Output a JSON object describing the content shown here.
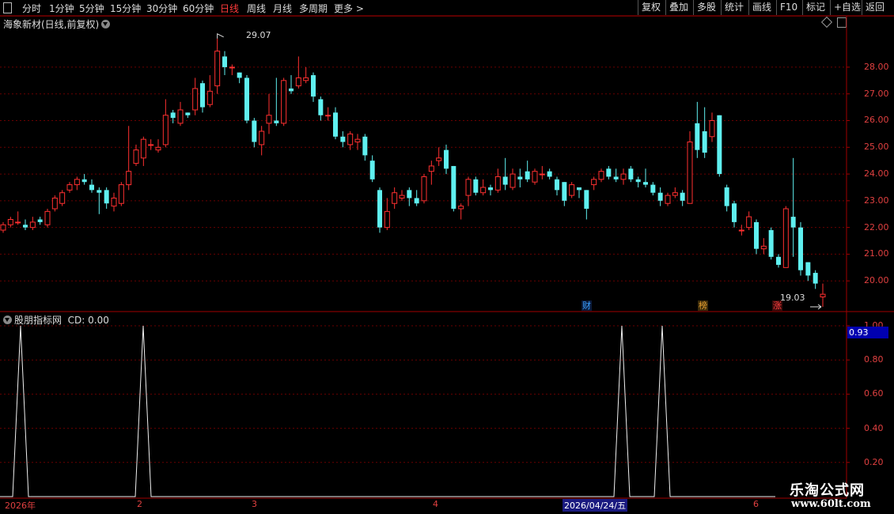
{
  "toolbar": {
    "periods": [
      "分时",
      "1分钟",
      "5分钟",
      "15分钟",
      "30分钟",
      "60分钟",
      "日线",
      "周线",
      "月线",
      "多周期",
      "更多"
    ],
    "active_period": "日线",
    "right_buttons": [
      "复权",
      "叠加",
      "多股",
      "统计",
      "画线",
      "F10",
      "标记",
      "+自选",
      "返回"
    ]
  },
  "main_chart": {
    "title": "海象新材(日线,前复权)",
    "price_labels": [
      "28.00",
      "27.00",
      "26.00",
      "25.00",
      "24.00",
      "23.00",
      "22.00",
      "21.00",
      "20.00"
    ],
    "high_label": "29.07",
    "low_label": "19.03",
    "markers": [
      {
        "text": "财",
        "color": "#3aa0ff"
      },
      {
        "text": "榜",
        "color": "#e8a030"
      },
      {
        "text": "涨",
        "color": "#ff4040"
      }
    ],
    "colors": {
      "up": "#ff3030",
      "down": "#5ff0f0",
      "grid": "#6a0000",
      "axis": "#a00000"
    }
  },
  "indicator": {
    "title": "股朋指标网",
    "cd_label": "CD: 0.00",
    "value_badge": "0.93",
    "axis_labels": [
      "1.00",
      "0.80",
      "0.60",
      "0.40",
      "0.20"
    ]
  },
  "x_axis": {
    "labels": [
      "2026年",
      "2",
      "3",
      "4",
      "2026/04/24/五",
      "6"
    ]
  },
  "watermark": {
    "line1": "乐淘公式网",
    "line2": "www.60lt.com"
  },
  "chart_data": {
    "type": "candlestick",
    "ylim": [
      19.0,
      29.3
    ],
    "candles": [
      [
        21.9,
        22.1,
        21.8,
        22.2
      ],
      [
        22.1,
        22.3,
        22.0,
        22.4
      ],
      [
        22.2,
        22.2,
        22.1,
        22.6
      ],
      [
        22.1,
        22.0,
        21.9,
        22.3
      ],
      [
        22.0,
        22.2,
        21.9,
        22.4
      ],
      [
        22.3,
        22.2,
        22.1,
        22.4
      ],
      [
        22.1,
        22.6,
        22.0,
        22.7
      ],
      [
        22.7,
        23.1,
        22.6,
        23.2
      ],
      [
        22.9,
        23.3,
        22.8,
        23.4
      ],
      [
        23.4,
        23.6,
        23.3,
        23.7
      ],
      [
        23.6,
        23.8,
        23.4,
        23.9
      ],
      [
        23.8,
        23.7,
        23.6,
        24.0
      ],
      [
        23.6,
        23.4,
        23.3,
        23.8
      ],
      [
        23.4,
        23.3,
        22.5,
        23.5
      ],
      [
        23.4,
        22.9,
        22.7,
        23.5
      ],
      [
        22.8,
        23.1,
        22.6,
        23.3
      ],
      [
        22.9,
        23.6,
        22.8,
        23.7
      ],
      [
        23.6,
        24.1,
        23.4,
        25.8
      ],
      [
        24.4,
        24.9,
        24.3,
        25.1
      ],
      [
        24.6,
        25.3,
        24.3,
        25.4
      ],
      [
        25.1,
        25.1,
        24.9,
        25.3
      ],
      [
        24.9,
        25.0,
        24.8,
        25.3
      ],
      [
        25.1,
        26.2,
        25.0,
        26.8
      ],
      [
        26.3,
        26.1,
        25.9,
        26.4
      ],
      [
        25.9,
        26.4,
        25.8,
        26.7
      ],
      [
        26.3,
        26.2,
        26.1,
        26.3
      ],
      [
        26.4,
        27.2,
        26.2,
        27.6
      ],
      [
        27.4,
        26.5,
        26.3,
        27.5
      ],
      [
        26.6,
        27.1,
        26.5,
        27.7
      ],
      [
        27.3,
        28.6,
        27.0,
        29.07
      ],
      [
        28.4,
        28.0,
        27.7,
        28.6
      ],
      [
        28.0,
        28.0,
        27.7,
        28.1
      ],
      [
        27.8,
        27.6,
        27.4,
        27.8
      ],
      [
        27.6,
        26.0,
        25.9,
        27.7
      ],
      [
        26.0,
        25.2,
        25.0,
        26.1
      ],
      [
        25.1,
        25.6,
        24.7,
        25.8
      ],
      [
        25.9,
        26.2,
        25.5,
        27.0
      ],
      [
        26.0,
        25.9,
        25.8,
        27.6
      ],
      [
        25.9,
        27.5,
        25.8,
        27.6
      ],
      [
        27.2,
        27.1,
        27.0,
        27.7
      ],
      [
        27.3,
        27.6,
        27.2,
        28.4
      ],
      [
        27.5,
        27.6,
        27.4,
        28.0
      ],
      [
        27.7,
        26.9,
        26.7,
        27.8
      ],
      [
        26.8,
        26.2,
        26.0,
        26.9
      ],
      [
        26.2,
        26.2,
        26.0,
        26.5
      ],
      [
        26.3,
        25.4,
        25.3,
        26.5
      ],
      [
        25.4,
        25.2,
        25.0,
        25.6
      ],
      [
        25.1,
        25.5,
        24.9,
        25.6
      ],
      [
        25.2,
        25.3,
        24.9,
        25.5
      ],
      [
        25.4,
        24.7,
        24.5,
        25.5
      ],
      [
        24.5,
        23.8,
        23.7,
        24.7
      ],
      [
        23.4,
        22.0,
        21.8,
        23.5
      ],
      [
        22.0,
        22.6,
        21.9,
        23.1
      ],
      [
        22.9,
        23.3,
        22.7,
        23.5
      ],
      [
        23.1,
        23.2,
        23.0,
        23.4
      ],
      [
        23.4,
        23.1,
        22.8,
        23.5
      ],
      [
        23.1,
        22.9,
        22.8,
        23.4
      ],
      [
        23.0,
        23.9,
        22.9,
        24.0
      ],
      [
        24.1,
        24.3,
        23.6,
        24.5
      ],
      [
        24.5,
        24.6,
        24.3,
        25.0
      ],
      [
        24.9,
        24.2,
        24.0,
        25.1
      ],
      [
        24.3,
        22.7,
        22.6,
        24.3
      ],
      [
        22.7,
        22.8,
        22.3,
        22.9
      ],
      [
        23.2,
        23.8,
        22.8,
        23.9
      ],
      [
        23.8,
        23.3,
        23.2,
        23.9
      ],
      [
        23.3,
        23.5,
        23.2,
        23.8
      ],
      [
        23.5,
        23.4,
        23.2,
        23.6
      ],
      [
        23.4,
        23.9,
        23.3,
        24.2
      ],
      [
        23.9,
        23.6,
        23.4,
        24.6
      ],
      [
        23.5,
        24.0,
        23.4,
        24.2
      ],
      [
        23.9,
        23.8,
        23.5,
        24.2
      ],
      [
        24.1,
        23.8,
        23.7,
        24.5
      ],
      [
        23.7,
        24.1,
        23.6,
        24.2
      ],
      [
        24.0,
        24.0,
        23.8,
        24.3
      ],
      [
        24.1,
        23.9,
        23.8,
        24.2
      ],
      [
        23.8,
        23.4,
        23.2,
        23.9
      ],
      [
        23.7,
        23.0,
        22.8,
        23.7
      ],
      [
        23.2,
        23.6,
        23.1,
        23.7
      ],
      [
        23.5,
        23.4,
        23.1,
        23.5
      ],
      [
        23.4,
        22.7,
        22.3,
        23.4
      ],
      [
        23.6,
        23.8,
        23.4,
        23.9
      ],
      [
        23.8,
        24.1,
        23.7,
        24.2
      ],
      [
        24.2,
        23.9,
        23.8,
        24.3
      ],
      [
        23.9,
        23.8,
        23.7,
        24.2
      ],
      [
        23.8,
        24.0,
        23.6,
        24.2
      ],
      [
        24.2,
        23.8,
        23.7,
        24.3
      ],
      [
        23.8,
        23.7,
        23.5,
        23.9
      ],
      [
        23.7,
        23.6,
        23.5,
        24.2
      ],
      [
        23.6,
        23.3,
        23.2,
        23.7
      ],
      [
        23.3,
        23.0,
        22.8,
        23.5
      ],
      [
        22.9,
        23.2,
        22.8,
        23.3
      ],
      [
        23.2,
        23.3,
        23.1,
        23.5
      ],
      [
        23.3,
        23.0,
        22.8,
        23.4
      ],
      [
        22.9,
        25.2,
        22.9,
        25.6
      ],
      [
        25.9,
        24.9,
        24.6,
        26.7
      ],
      [
        25.6,
        24.8,
        24.6,
        26.5
      ],
      [
        25.4,
        26.0,
        25.2,
        26.3
      ],
      [
        26.2,
        24.0,
        23.9,
        26.2
      ],
      [
        23.5,
        22.8,
        22.6,
        23.6
      ],
      [
        22.9,
        22.2,
        22.0,
        23.0
      ],
      [
        21.9,
        21.9,
        21.7,
        22.1
      ],
      [
        22.0,
        22.4,
        21.9,
        22.6
      ],
      [
        22.2,
        21.2,
        21.0,
        22.3
      ],
      [
        21.2,
        21.3,
        21.0,
        21.6
      ],
      [
        21.9,
        20.9,
        20.8,
        22.0
      ],
      [
        20.9,
        20.6,
        20.5,
        21.0
      ],
      [
        20.5,
        22.7,
        20.5,
        22.8
      ],
      [
        22.4,
        22.0,
        20.9,
        24.6
      ],
      [
        22.0,
        20.4,
        20.2,
        22.2
      ],
      [
        20.7,
        20.2,
        20.0,
        20.7
      ],
      [
        20.3,
        19.9,
        19.7,
        20.4
      ],
      [
        19.4,
        19.5,
        19.03,
        19.9
      ]
    ],
    "indicator_peaks": [
      1.0,
      1.0,
      1.0,
      1.0
    ],
    "indicator_ylim": [
      0,
      1.0
    ]
  }
}
